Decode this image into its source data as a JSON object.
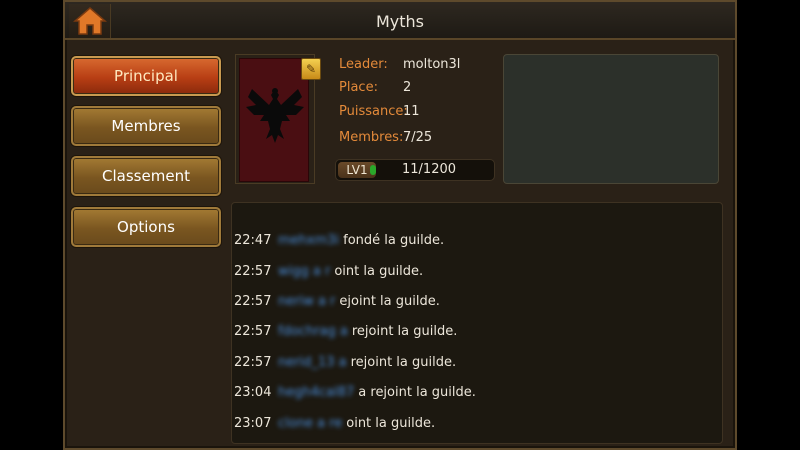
{
  "header": {
    "title": "Myths",
    "home_icon": "home-icon"
  },
  "nav": {
    "items": [
      {
        "label": "Principal",
        "active": true
      },
      {
        "label": "Membres",
        "active": false
      },
      {
        "label": "Classement",
        "active": false
      },
      {
        "label": "Options",
        "active": false
      }
    ]
  },
  "guild": {
    "leader_label": "Leader:",
    "leader_value": "molton3l",
    "place_label": "Place:",
    "place_value": "2",
    "power_label": "Puissance:",
    "power_value": "11",
    "members_label": "Membres:",
    "members_value": "7/25",
    "level_label": "LV1",
    "xp_text": "11/1200",
    "xp_progress": 0.009,
    "banner_color": "#4a0e12",
    "emblem_icon": "eagle-emblem-icon",
    "edit_icon": "edit-icon"
  },
  "log": [
    {
      "time": "22:47",
      "name": "mehxm3i",
      "text": "fondé la guilde."
    },
    {
      "time": "22:57",
      "name": "wigg a r",
      "text": "oint la guilde."
    },
    {
      "time": "22:57",
      "name": "neriw a r",
      "text": "ejoint la guilde."
    },
    {
      "time": "22:57",
      "name": "fdochrag a",
      "text": "rejoint la guilde."
    },
    {
      "time": "22:57",
      "name": "nerid_13 a",
      "text": "rejoint la guilde."
    },
    {
      "time": "23:04",
      "name": "hegh4cal87",
      "text": "a rejoint la guilde."
    },
    {
      "time": "23:07",
      "name": "clone a re",
      "text": "oint la guilde."
    }
  ],
  "colors": {
    "accent": "#e48a3a",
    "active_button": "#b83e14",
    "button": "#7a5620",
    "name_blue": "#4a90e0"
  }
}
